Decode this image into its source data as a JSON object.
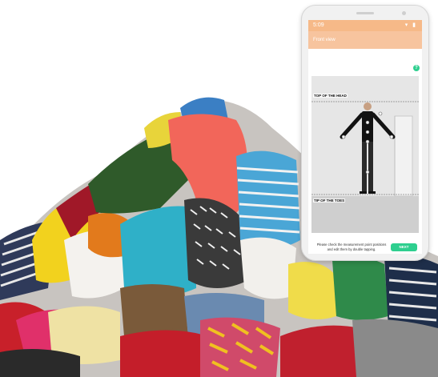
{
  "phone": {
    "status_time": "5:09",
    "status_icons": "▾ ▮",
    "app_title": "Front view",
    "help_icon": "?",
    "labels": {
      "top_of_head": "TOP OF THE HEAD",
      "tip_of_toes": "TIP OF THE TOES"
    },
    "instructions": "Please check the measurement point positions and edit them by double tapping.",
    "next_label": "NEXT"
  },
  "colors": {
    "accent_orange": "#f6b988",
    "accent_green": "#2ecf8f"
  },
  "icons": [
    "help-icon",
    "battery-icon",
    "signal-icon"
  ]
}
